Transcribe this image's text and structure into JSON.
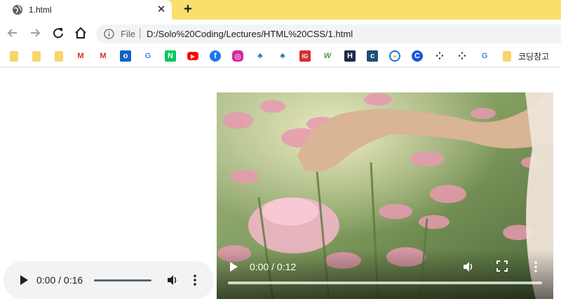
{
  "tab": {
    "title": "1.html",
    "close_icon": "close-icon",
    "favicon": "globe-icon"
  },
  "newtab": {
    "label": "+"
  },
  "nav": {
    "back": "back-arrow-icon",
    "forward": "forward-arrow-icon",
    "reload": "reload-icon",
    "home": "home-icon"
  },
  "omnibox": {
    "scheme": "File",
    "url": "D:/Solo%20Coding/Lectures/HTML%20CSS/1.html"
  },
  "bookmarks": {
    "items": [
      {
        "icon": "folder-icon"
      },
      {
        "icon": "folder-icon"
      },
      {
        "icon": "folder-icon"
      },
      {
        "icon": "gmail-icon",
        "glyph": "M"
      },
      {
        "icon": "gmail-icon",
        "glyph": "M"
      },
      {
        "icon": "outlook-icon",
        "glyph": "o"
      },
      {
        "icon": "google-icon",
        "glyph": "G"
      },
      {
        "icon": "naver-icon",
        "glyph": "N"
      },
      {
        "icon": "youtube-icon",
        "glyph": "▶"
      },
      {
        "icon": "facebook-icon",
        "glyph": "f"
      },
      {
        "icon": "instagram-icon",
        "glyph": "◎"
      },
      {
        "icon": "people-icon",
        "glyph": "♣"
      },
      {
        "icon": "people-icon",
        "glyph": "♣"
      },
      {
        "icon": "ig-icon",
        "glyph": "IG"
      },
      {
        "icon": "w-icon",
        "glyph": "W"
      },
      {
        "icon": "h-icon",
        "glyph": "H"
      },
      {
        "icon": "c-square-icon",
        "glyph": "c"
      },
      {
        "icon": "circle-icon",
        "glyph": "●"
      },
      {
        "icon": "c-circle-icon",
        "glyph": "C"
      },
      {
        "icon": "dots-icon",
        "glyph": "⁘"
      },
      {
        "icon": "dots-icon",
        "glyph": "⁘"
      },
      {
        "icon": "google-icon",
        "glyph": "G"
      },
      {
        "icon": "folder-icon"
      }
    ],
    "folder_label": "코딩참고"
  },
  "audio": {
    "time": "0:00 / 0:16"
  },
  "video": {
    "time": "0:00 / 0:12"
  },
  "colors": {
    "tabstrip": "#fbdf6c",
    "omnibox": "#f1f3f4",
    "audio_bg": "#f1f3f4"
  }
}
